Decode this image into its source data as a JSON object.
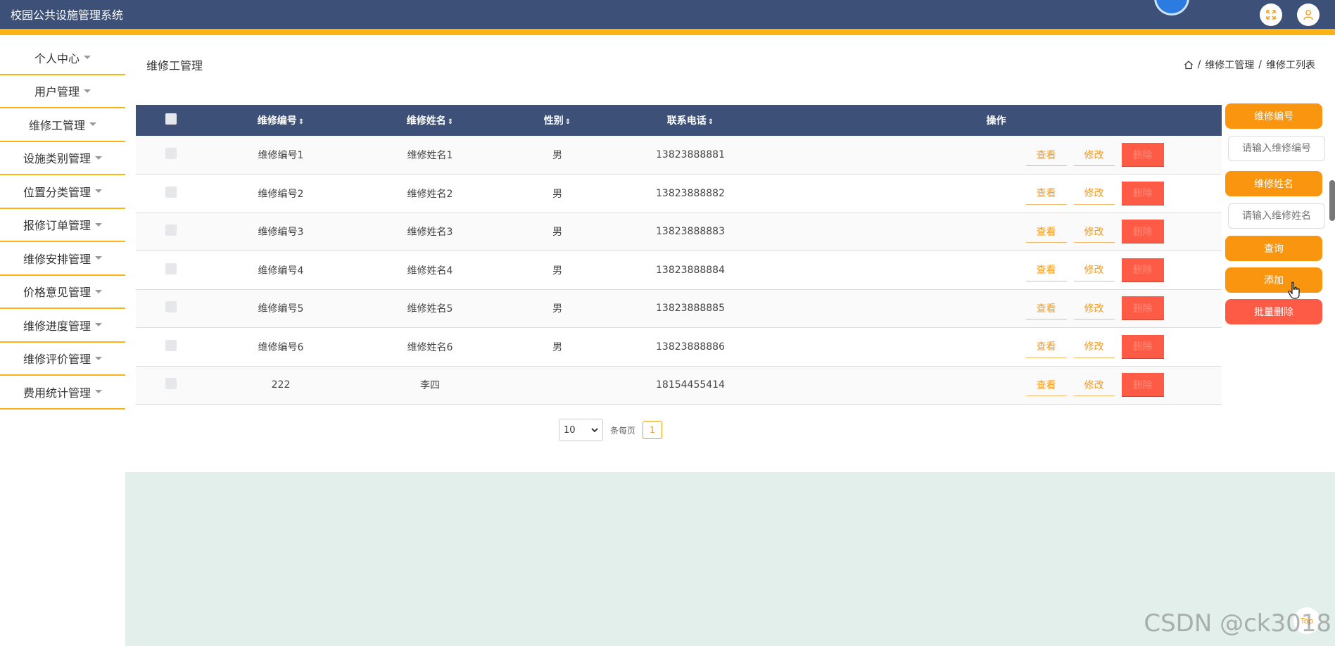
{
  "app": {
    "title": "校园公共设施管理系统",
    "brand_color": "#3c5078",
    "accent_color": "#fbb214",
    "header_icons": [
      "fullscreen-icon",
      "user-icon"
    ]
  },
  "sidebar": {
    "items": [
      {
        "label": "个人中心"
      },
      {
        "label": "用户管理"
      },
      {
        "label": "维修工管理"
      },
      {
        "label": "设施类别管理"
      },
      {
        "label": "位置分类管理"
      },
      {
        "label": "报修订单管理"
      },
      {
        "label": "维修安排管理"
      },
      {
        "label": "价格意见管理"
      },
      {
        "label": "维修进度管理"
      },
      {
        "label": "维修评价管理"
      },
      {
        "label": "费用统计管理"
      }
    ]
  },
  "main": {
    "title": "维修工管理",
    "breadcrumb": {
      "home_icon": "home-icon",
      "sep": "/",
      "level1": "维修工管理",
      "level2": "维修工列表"
    }
  },
  "table": {
    "headers": {
      "col1": "维修编号",
      "col2": "维修姓名",
      "col3": "性别",
      "col4": "联系电话",
      "col5": "操作",
      "sort_icon": "⇕"
    },
    "rows": [
      {
        "code": "维修编号1",
        "name": "维修姓名1",
        "gender": "男",
        "phone": "13823888881"
      },
      {
        "code": "维修编号2",
        "name": "维修姓名2",
        "gender": "男",
        "phone": "13823888882"
      },
      {
        "code": "维修编号3",
        "name": "维修姓名3",
        "gender": "男",
        "phone": "13823888883"
      },
      {
        "code": "维修编号4",
        "name": "维修姓名4",
        "gender": "男",
        "phone": "13823888884"
      },
      {
        "code": "维修编号5",
        "name": "维修姓名5",
        "gender": "男",
        "phone": "13823888885"
      },
      {
        "code": "维修编号6",
        "name": "维修姓名6",
        "gender": "男",
        "phone": "13823888886"
      },
      {
        "code": "222",
        "name": "李四",
        "gender": "",
        "phone": "18154455414"
      }
    ],
    "actions": {
      "view": "查看",
      "edit": "修改",
      "delete": "删除"
    }
  },
  "pagination": {
    "page_size": "10",
    "per_page_label": "条每页",
    "current_page": "1"
  },
  "search_panel": {
    "code_label": "维修编号",
    "code_placeholder": "请输入维修编号",
    "name_label": "维修姓名",
    "name_placeholder": "请输入维修姓名",
    "query_label": "查询",
    "add_label": "添加",
    "batch_delete_label": "批量删除"
  },
  "misc": {
    "watermark": "CSDN @ck3018",
    "top_button": "Top"
  }
}
